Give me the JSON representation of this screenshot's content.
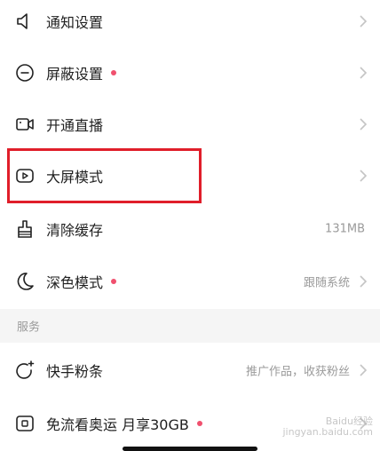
{
  "items": [
    {
      "label": "通知设置",
      "icon": "speaker-icon"
    },
    {
      "label": "屏蔽设置",
      "icon": "block-icon",
      "dot": true
    },
    {
      "label": "开通直播",
      "icon": "video-camera-icon"
    },
    {
      "label": "大屏模式",
      "icon": "play-screen-icon"
    },
    {
      "label": "清除缓存",
      "icon": "broom-icon",
      "value": "131MB"
    },
    {
      "label": "深色模式",
      "icon": "moon-icon",
      "dot": true,
      "value": "跟随系统"
    },
    {
      "label": "快手粉条",
      "icon": "sparkle-icon",
      "value": "推广作品，收获粉丝"
    },
    {
      "label": "免流看奥运 月享30GB",
      "icon": "sim-card-icon",
      "dot": true
    }
  ],
  "section_title": "服务",
  "watermark": "Baidu经验\njingyan.baidu.com",
  "colors": {
    "accent": "#e01e2a",
    "dot": "#f0506e",
    "text": "#1f1f1f",
    "muted": "#9a9a9a"
  }
}
